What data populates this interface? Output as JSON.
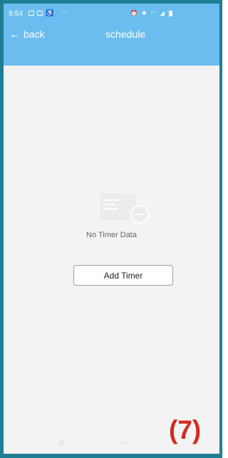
{
  "status_bar": {
    "time": "9:54",
    "left_icons": [
      "image-icon",
      "image-icon",
      "accessibility-icon"
    ],
    "dots": "···",
    "right_icons": [
      "alarm-icon",
      "bluetooth-icon",
      "wifi-icon",
      "signal-icon",
      "battery-icon"
    ]
  },
  "app_bar": {
    "back_label": "back",
    "back_icon": "arrow-left-icon",
    "title": "schedule"
  },
  "empty_state": {
    "icon": "timer-card-icon",
    "message": "No Timer Data",
    "button_label": "Add Timer"
  },
  "annotation": {
    "label": "(7)"
  },
  "colors": {
    "accent": "#6bbdf0",
    "frame": "#1f7e94",
    "background": "#f3f3f3",
    "annotation": "#d42a20"
  }
}
